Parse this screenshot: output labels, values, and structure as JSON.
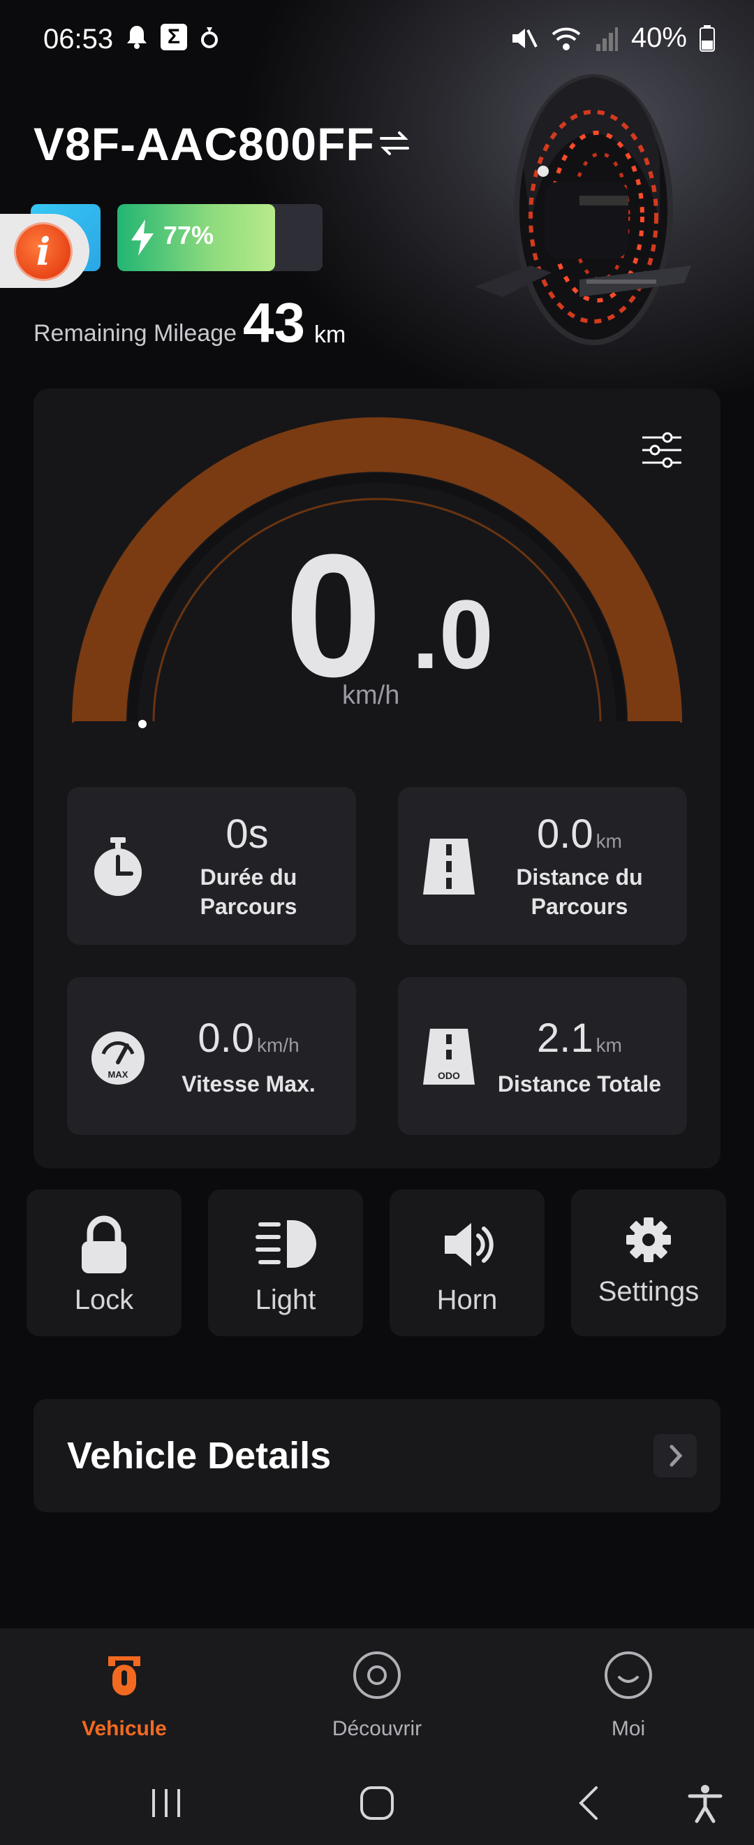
{
  "status_bar": {
    "time": "06:53",
    "battery_percent": "40%",
    "icons_left": [
      "bell-icon",
      "sigma-app-icon",
      "ring-icon"
    ],
    "icons_right": [
      "mute-icon",
      "wifi-6e-icon",
      "signal-icon",
      "battery-icon"
    ]
  },
  "vehicle": {
    "name": "V8F-AAC800FF",
    "battery_level": 0.77,
    "battery_label": "77%",
    "mileage_label": "Remaining Mileage",
    "mileage_value": "43",
    "mileage_unit": "km"
  },
  "speedometer": {
    "speed_int": "0",
    "speed_dec": ".0",
    "unit": "km/h",
    "gauge_fraction": 0.0
  },
  "stats": [
    {
      "value": "0s",
      "unit": "",
      "label_line1": "Durée du",
      "label_line2": "Parcours",
      "icon": "stopwatch-icon"
    },
    {
      "value": "0.0",
      "unit": "km",
      "label_line1": "Distance du",
      "label_line2": "Parcours",
      "icon": "road-icon"
    },
    {
      "value": "0.0",
      "unit": "km/h",
      "label_line1": "Vitesse Max.",
      "label_line2": "",
      "icon": "max-speed-gauge-icon"
    },
    {
      "value": "2.1",
      "unit": "km",
      "label_line1": "Distance Totale",
      "label_line2": "",
      "icon": "odometer-road-icon"
    }
  ],
  "actions": [
    {
      "label": "Lock",
      "icon": "lock-icon"
    },
    {
      "label": "Light",
      "icon": "headlight-icon"
    },
    {
      "label": "Horn",
      "icon": "horn-speaker-icon"
    },
    {
      "label": "Settings",
      "icon": "gear-icon"
    }
  ],
  "details": {
    "title": "Vehicle Details"
  },
  "bottom_nav": [
    {
      "label": "Vehicule",
      "active": true,
      "icon": "wheel-icon"
    },
    {
      "label": "Découvrir",
      "active": false,
      "icon": "discover-icon"
    },
    {
      "label": "Moi",
      "active": false,
      "icon": "profile-smile-icon"
    }
  ],
  "colors": {
    "accent": "#f26a21",
    "gauge_arc": "#6b3410",
    "battery_fill": "#22b573",
    "card_bg": "#161619"
  }
}
